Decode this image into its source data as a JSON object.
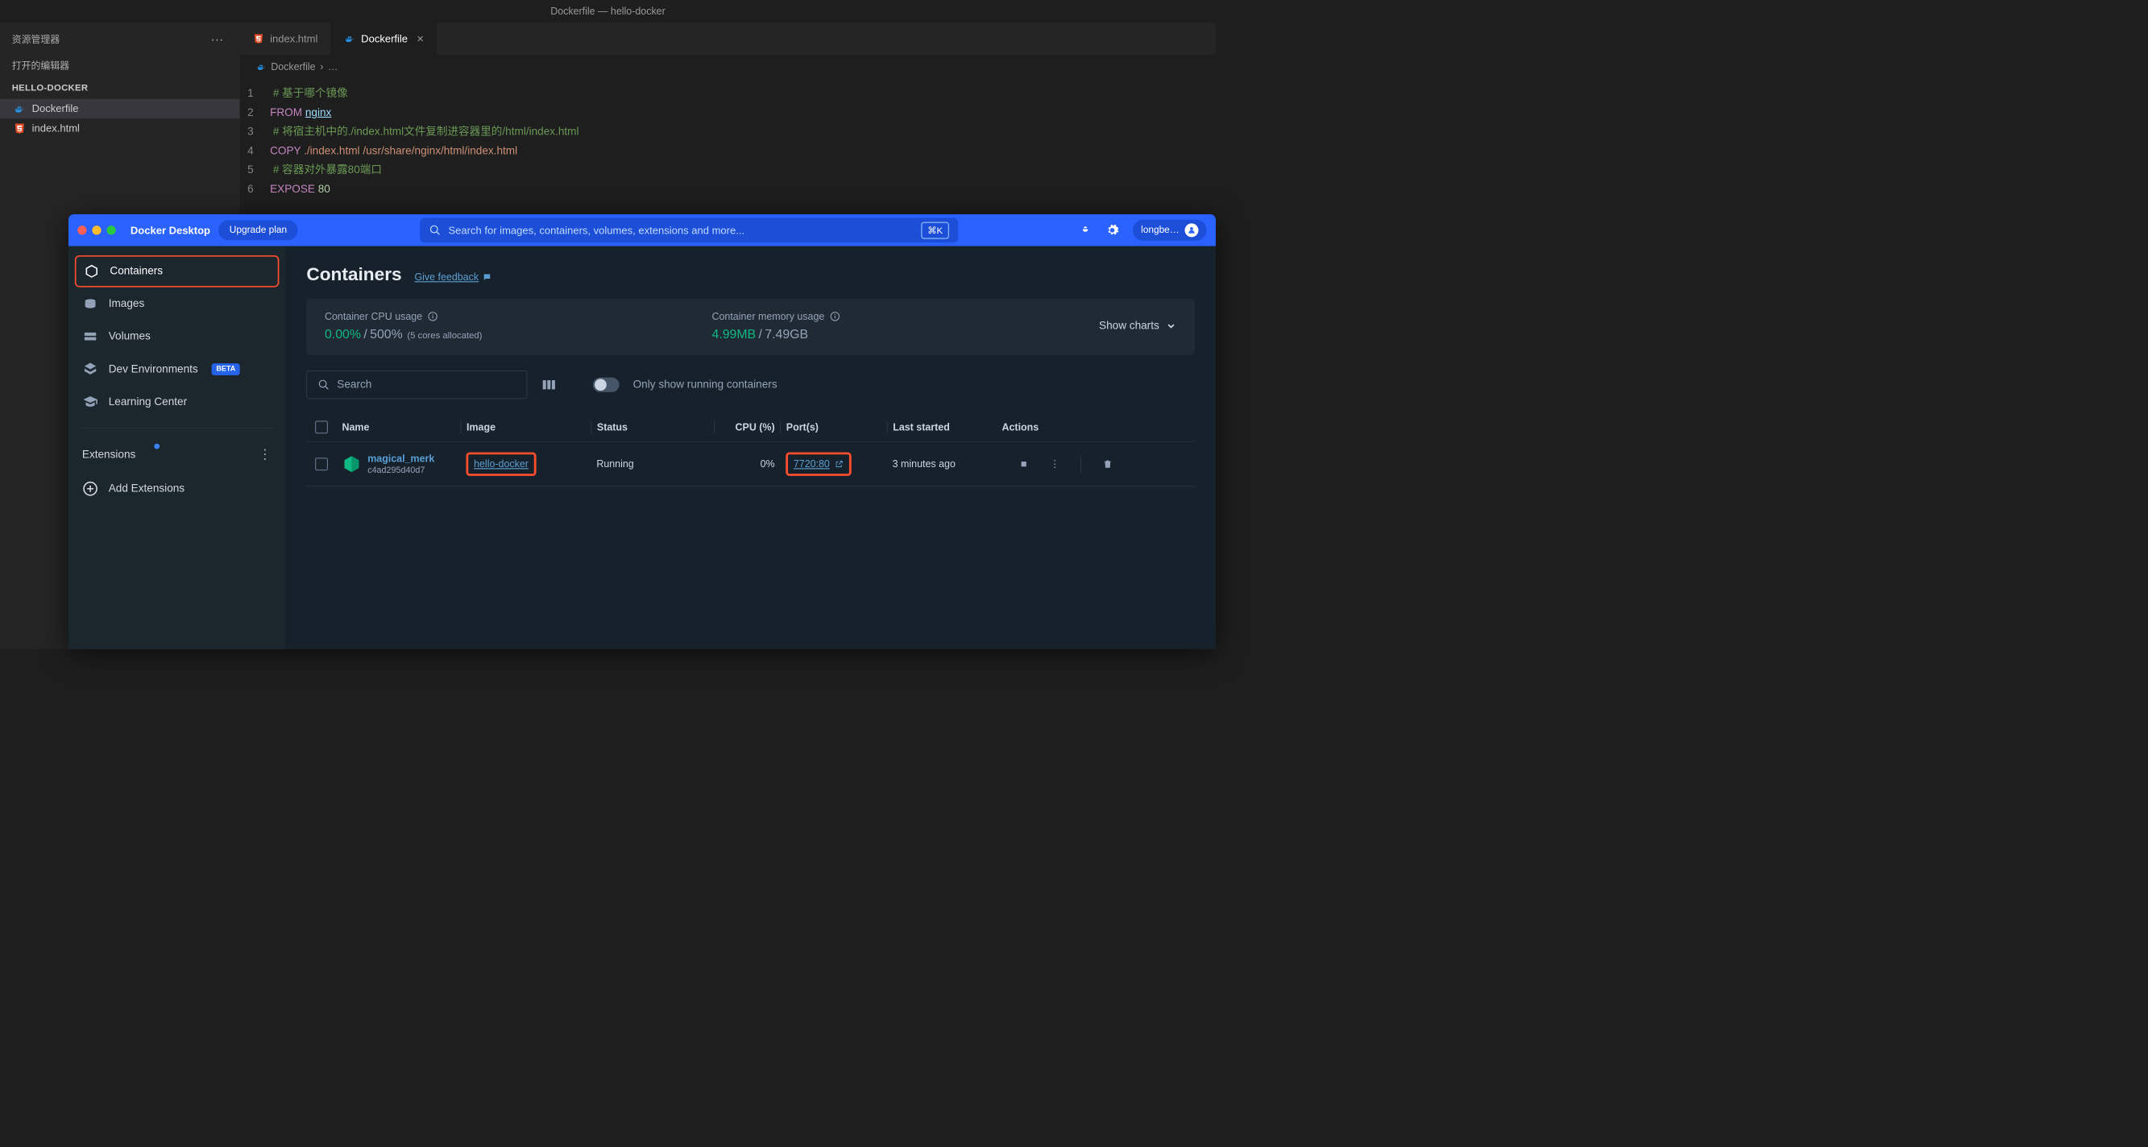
{
  "vscode": {
    "window_title": "Dockerfile — hello-docker",
    "explorer_label": "资源管理器",
    "open_editors_label": "打开的编辑器",
    "project_name": "HELLO-DOCKER",
    "files": [
      {
        "name": "Dockerfile",
        "icon": "docker"
      },
      {
        "name": "index.html",
        "icon": "html"
      }
    ],
    "tabs": [
      {
        "label": "index.html",
        "icon": "html",
        "active": false
      },
      {
        "label": "Dockerfile",
        "icon": "docker",
        "active": true
      }
    ],
    "breadcrumb": [
      "Dockerfile",
      "…"
    ],
    "code": {
      "lines": [
        {
          "n": "1",
          "comment": "# 基于哪个镜像"
        },
        {
          "n": "2",
          "key": "FROM",
          "link": "nginx"
        },
        {
          "n": "3",
          "comment": "# 将宿主机中的./index.html文件复制进容器里的/html/index.html"
        },
        {
          "n": "4",
          "key": "COPY",
          "str": "./index.html /usr/share/nginx/html/index.html"
        },
        {
          "n": "5",
          "comment": "# 容器对外暴露80端口"
        },
        {
          "n": "6",
          "key": "EXPOSE",
          "num": "80"
        }
      ]
    }
  },
  "docker": {
    "app_title": "Docker Desktop",
    "upgrade": "Upgrade plan",
    "search_placeholder": "Search for images, containers, volumes, extensions and more...",
    "search_shortcut": "⌘K",
    "username": "longbe…",
    "sidebar": {
      "items": {
        "0": {
          "label": "Containers"
        },
        "1": {
          "label": "Images"
        },
        "2": {
          "label": "Volumes"
        },
        "3": {
          "label": "Dev Environments"
        },
        "4": {
          "label": "Learning Center"
        }
      },
      "beta": "BETA",
      "extensions_label": "Extensions",
      "add_label": "Add Extensions"
    },
    "main": {
      "title": "Containers",
      "feedback": "Give feedback",
      "cpu_label": "Container CPU usage",
      "cpu_used": "0.00%",
      "cpu_total": "500%",
      "cpu_note": "(5 cores allocated)",
      "mem_label": "Container memory usage",
      "mem_used": "4.99MB",
      "mem_total": "7.49GB",
      "show_charts": "Show charts",
      "search_placeholder": "Search",
      "toggle_label": "Only show running containers",
      "columns": {
        "name": "Name",
        "image": "Image",
        "status": "Status",
        "cpu": "CPU (%)",
        "ports": "Port(s)",
        "last": "Last started",
        "actions": "Actions"
      },
      "rows": [
        {
          "name": "magical_merk",
          "id": "c4ad295d40d7",
          "image": "hello-docker",
          "status": "Running",
          "cpu": "0%",
          "port": "7720:80",
          "last": "3 minutes ago"
        }
      ]
    }
  }
}
